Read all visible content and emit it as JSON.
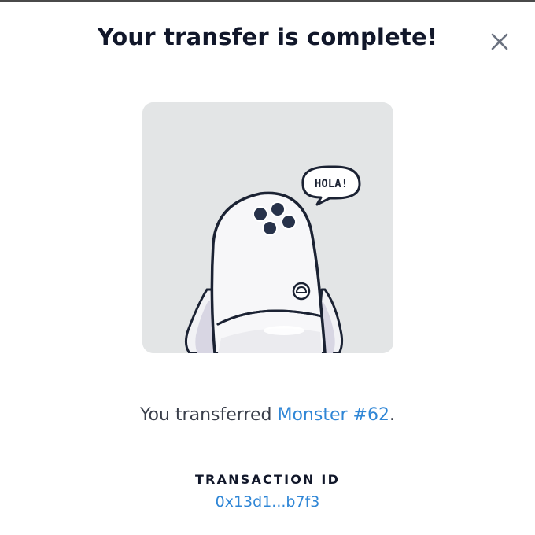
{
  "modal": {
    "title": "Your transfer is complete!",
    "close_icon": "close-icon"
  },
  "nft": {
    "speech_bubble": "HOLA!",
    "background_color": "#e3e5e6"
  },
  "message": {
    "prefix": "You transferred ",
    "item_name": "Monster #62",
    "suffix": "."
  },
  "transaction": {
    "label": "TRANSACTION ID",
    "id": "0x13d1...b7f3"
  },
  "colors": {
    "accent_link": "#2f86d6",
    "title_text": "#11172a",
    "body_text": "#3a3f4b"
  }
}
